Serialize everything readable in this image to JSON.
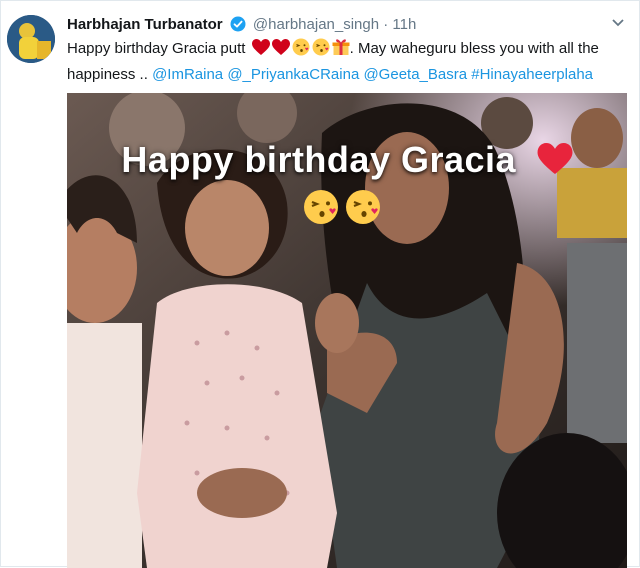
{
  "tweet": {
    "author_name": "Harbhajan Turbanator",
    "author_handle": "@harbhajan_singh",
    "separator": "·",
    "time": "11h",
    "text_part1": "Happy birthday Gracia putt",
    "text_part2": ". May waheguru bless you with all the happiness ..",
    "mentions": [
      "@ImRaina",
      "@_PriyankaCRaina",
      "@Geeta_Basra"
    ],
    "hashtag": "#Hinayaheerplaha",
    "emojis": [
      "heart-icon",
      "heart-icon",
      "kissing-face-icon",
      "kissing-face-icon",
      "gift-icon"
    ]
  },
  "media": {
    "overlay_text": "Happy birthday Gracia",
    "overlay_emojis": [
      "heart-icon",
      "kissing-face-icon",
      "kissing-face-icon"
    ]
  },
  "colors": {
    "link": "#1b95e0",
    "muted": "#657786",
    "heart": "#d0021b",
    "verified": "#1da1f2"
  }
}
